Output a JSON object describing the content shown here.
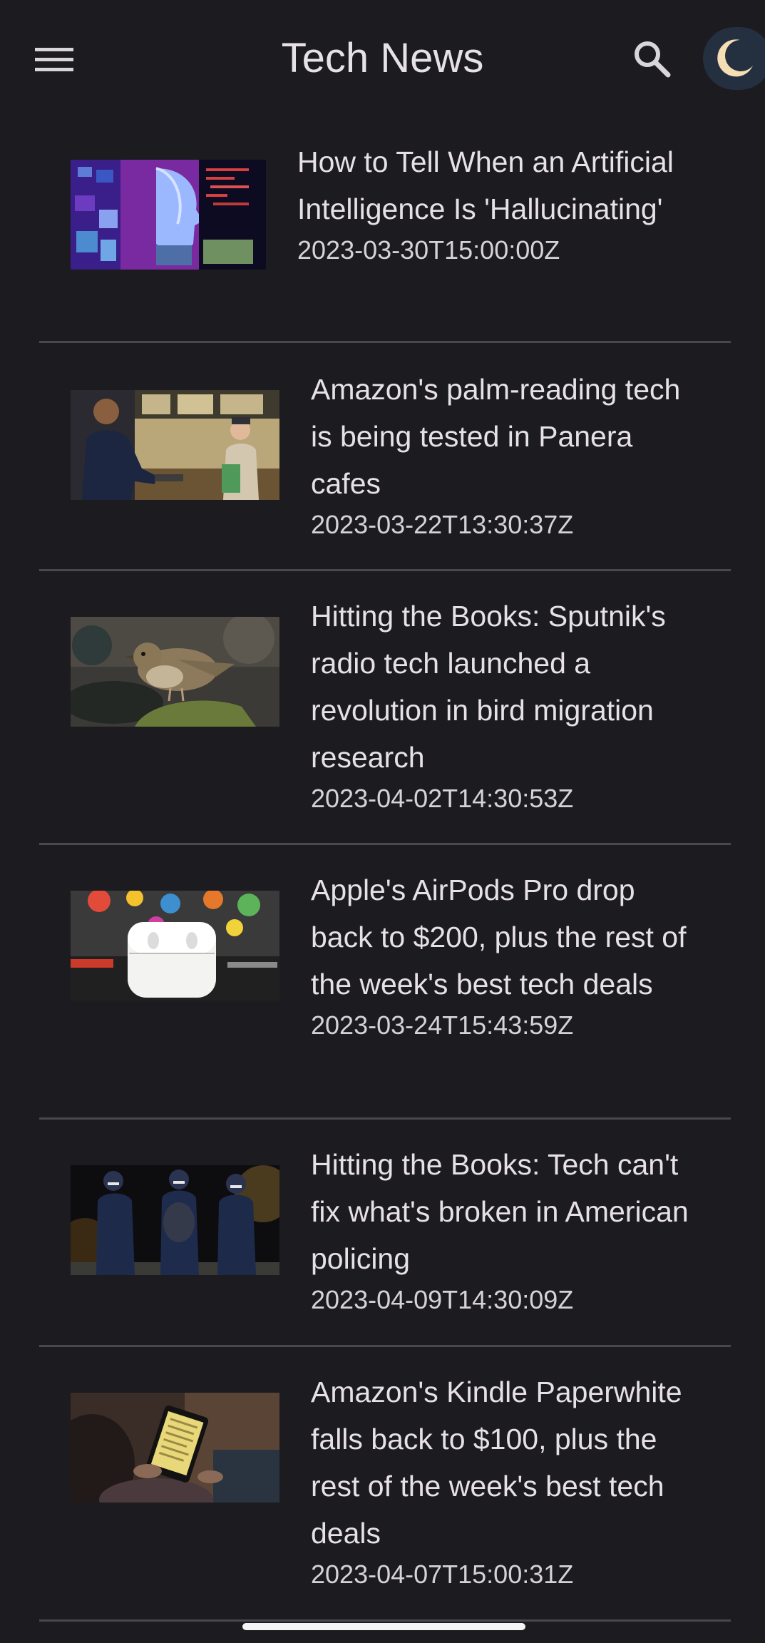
{
  "app_bar": {
    "title": "Tech News",
    "menu_icon": "hamburger-menu-icon",
    "search_icon": "search-icon",
    "theme_icon": "moon-icon"
  },
  "articles": [
    {
      "title": "How to Tell When an Artificial Intelligence Is 'Hallucinating'",
      "published": "2023-03-30T15:00:00Z",
      "thumbnail": "ai-face-circuit-image"
    },
    {
      "title": "Amazon's palm-reading tech is being tested in Panera cafes",
      "published": "2023-03-22T13:30:37Z",
      "thumbnail": "cafe-palm-scanner-image"
    },
    {
      "title": "Hitting the Books: Sputnik's radio tech launched a revolution in bird migration research",
      "published": "2023-04-02T14:30:53Z",
      "thumbnail": "thrush-bird-image"
    },
    {
      "title": "Apple's AirPods Pro drop back to $200, plus the rest of the week's best tech deals",
      "published": "2023-03-24T15:43:59Z",
      "thumbnail": "airpods-case-image"
    },
    {
      "title": "Hitting the Books: Tech can't fix what's broken in American policing",
      "published": "2023-04-09T14:30:09Z",
      "thumbnail": "police-officers-image"
    },
    {
      "title": "Amazon's Kindle Paperwhite falls back to $100, plus the rest of the week's best tech deals",
      "published": "2023-04-07T15:00:31Z",
      "thumbnail": "kindle-reader-image"
    }
  ],
  "colors": {
    "background": "#1c1b1f",
    "text": "#e6e1e5",
    "divider": "#4a484f",
    "moon": "#f5deb3"
  }
}
